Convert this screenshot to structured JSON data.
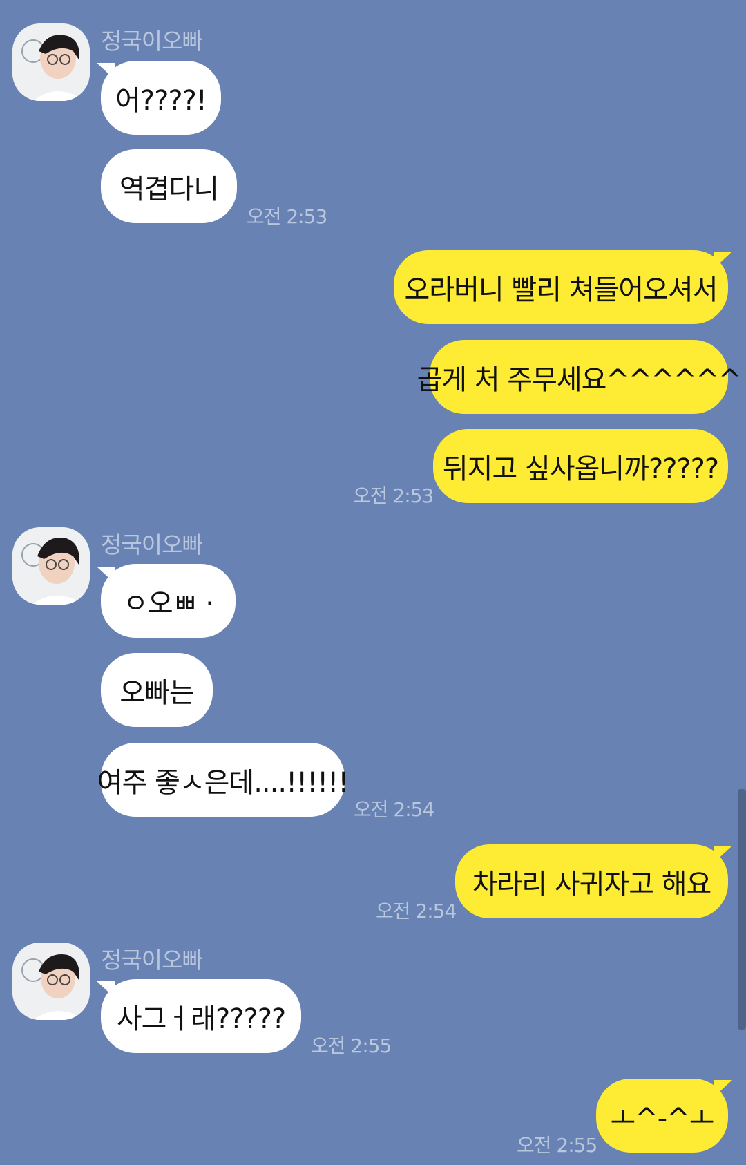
{
  "sender_name": "정국이오빠",
  "messages": [
    {
      "from": "friend",
      "text": "어????!"
    },
    {
      "from": "friend",
      "text": "역겹다니",
      "time": "오전 2:53"
    },
    {
      "from": "me",
      "text": "오라버니 빨리 쳐들어오셔서"
    },
    {
      "from": "me",
      "text": "곱게 처 주무세요^^^^^^"
    },
    {
      "from": "me",
      "text": "뒤지고 싶사옵니까?????",
      "time": "오전 2:53"
    },
    {
      "from": "friend",
      "text": "ㅇ오ㅃ ·"
    },
    {
      "from": "friend",
      "text": "오빠는"
    },
    {
      "from": "friend",
      "text": "여주 좋ㅅ은데....!!!!!!",
      "time": "오전 2:54"
    },
    {
      "from": "me",
      "text": "차라리 사귀자고 해요",
      "time": "오전 2:54"
    },
    {
      "from": "friend",
      "text": "사그ㅓ래?????",
      "time": "오전 2:55"
    },
    {
      "from": "me",
      "text": "ㅗ^-^ㅗ",
      "time": "오전 2:55"
    }
  ]
}
